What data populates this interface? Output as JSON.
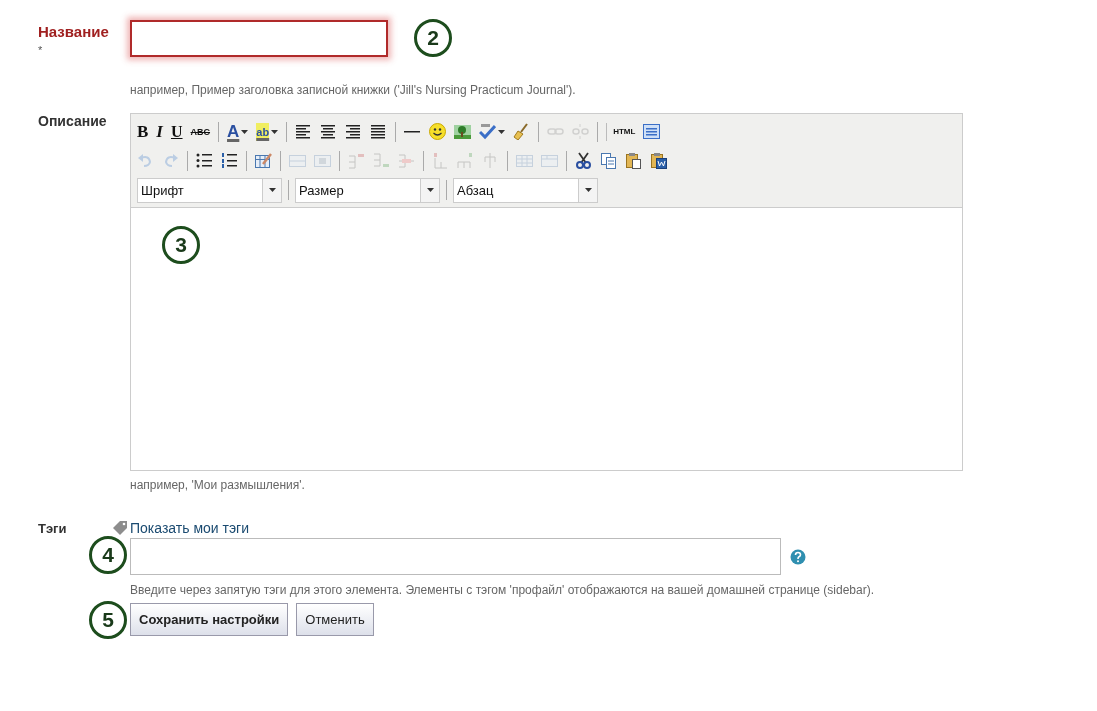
{
  "title_field": {
    "label": "Название",
    "required_mark": "*",
    "invalid": true,
    "marker": "2",
    "hint": "например, Пример заголовка записной книжки ('Jill's Nursing Practicum Journal')."
  },
  "description_field": {
    "label": "Описание",
    "marker": "3",
    "hint": "например, 'Мои размышления'.",
    "toolbar": [
      [
        {
          "kind": "bold",
          "label": "B"
        },
        {
          "kind": "italic",
          "label": "I"
        },
        {
          "kind": "underline",
          "label": "U"
        },
        {
          "kind": "strike",
          "label": "ABC"
        },
        {
          "kind": "sep"
        },
        {
          "kind": "forecolor",
          "label": "A"
        },
        {
          "kind": "arrow"
        },
        {
          "kind": "backcolor",
          "label": "ab"
        },
        {
          "kind": "arrow"
        },
        {
          "kind": "sep"
        },
        {
          "kind": "alignleft"
        },
        {
          "kind": "aligncenter"
        },
        {
          "kind": "alignright"
        },
        {
          "kind": "justify"
        },
        {
          "kind": "sep"
        },
        {
          "kind": "hr"
        },
        {
          "kind": "smiley"
        },
        {
          "kind": "image"
        },
        {
          "kind": "spellcheck"
        },
        {
          "kind": "arrow"
        },
        {
          "kind": "cleanup"
        },
        {
          "kind": "sep"
        },
        {
          "kind": "link",
          "disabled": true
        },
        {
          "kind": "unlink",
          "disabled": true
        },
        {
          "kind": "sep"
        },
        {
          "kind": "html",
          "label": "HTML"
        },
        {
          "kind": "preview"
        }
      ],
      [
        {
          "kind": "undo",
          "disabled": true
        },
        {
          "kind": "redo",
          "disabled": true
        },
        {
          "kind": "sep"
        },
        {
          "kind": "bullist"
        },
        {
          "kind": "numlist"
        },
        {
          "kind": "sep"
        },
        {
          "kind": "table"
        },
        {
          "kind": "sep"
        },
        {
          "kind": "rowprops",
          "disabled": true
        },
        {
          "kind": "cellprops",
          "disabled": true
        },
        {
          "kind": "sep"
        },
        {
          "kind": "rowbefore",
          "disabled": true
        },
        {
          "kind": "rowafter",
          "disabled": true
        },
        {
          "kind": "deleterow",
          "disabled": true
        },
        {
          "kind": "sep"
        },
        {
          "kind": "colbefore",
          "disabled": true
        },
        {
          "kind": "colafter",
          "disabled": true
        },
        {
          "kind": "deletecol",
          "disabled": true
        },
        {
          "kind": "sep"
        },
        {
          "kind": "split",
          "disabled": true
        },
        {
          "kind": "merge",
          "disabled": true
        },
        {
          "kind": "sep"
        },
        {
          "kind": "cut"
        },
        {
          "kind": "copy"
        },
        {
          "kind": "paste"
        },
        {
          "kind": "pasteword"
        }
      ]
    ],
    "selects": [
      {
        "value": "Шрифт"
      },
      {
        "value": "Размер"
      },
      {
        "value": "Абзац"
      }
    ]
  },
  "tags_field": {
    "label": "Тэги",
    "link": "Показать мои тэги",
    "marker": "4",
    "hint": "Введите через запятую тэги для этого элемента. Элементы с тэгом 'профайл' отображаются на вашей домашней странице (sidebar)."
  },
  "actions": {
    "marker": "5",
    "buttons": [
      {
        "label": "Сохранить настройки",
        "primary": true
      },
      {
        "label": "Отменить",
        "primary": false
      }
    ]
  }
}
